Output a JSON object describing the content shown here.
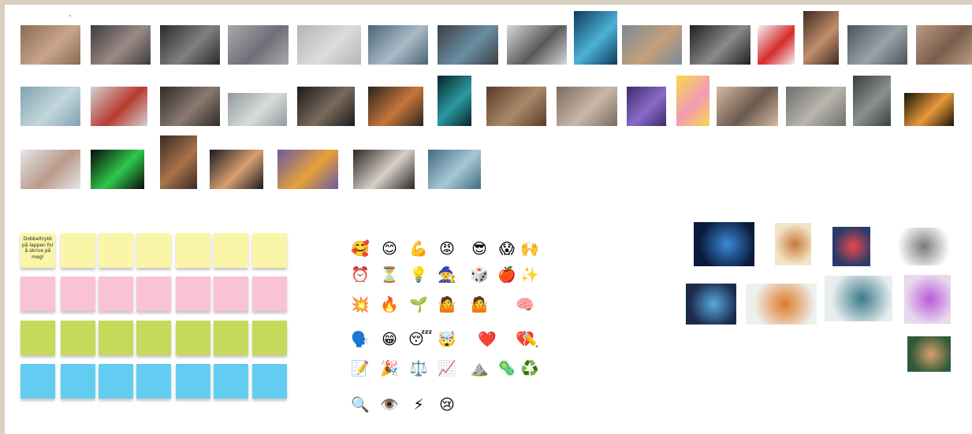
{
  "board": {
    "note_text": "Dobbeltrykk på lappen for å skrive på meg!",
    "note_colors": {
      "yellow": "#fbf5a8",
      "pink": "#f9c2d6",
      "green": "#c6d95a",
      "blue": "#63cdf1"
    }
  },
  "photos": [
    {
      "name": "photo-kids-classroom",
      "colors": [
        "#8b6a55",
        "#c9a58c"
      ]
    },
    {
      "name": "photo-people-phones",
      "colors": [
        "#3d3d3d",
        "#9a8a86"
      ]
    },
    {
      "name": "photo-audience-bw",
      "colors": [
        "#2a2a2a",
        "#808080"
      ]
    },
    {
      "name": "photo-laptop-hands",
      "colors": [
        "#a8a8ad",
        "#6f6f78"
      ]
    },
    {
      "name": "photo-blank-sign",
      "colors": [
        "#b5b5b5",
        "#dcdcdc"
      ]
    },
    {
      "name": "photo-ocean-figure",
      "colors": [
        "#4d6577",
        "#a9bbc6"
      ]
    },
    {
      "name": "photo-video-call",
      "colors": [
        "#3b3f44",
        "#6a8ea3"
      ]
    },
    {
      "name": "photo-shouting-kid",
      "colors": [
        "#d7d7d7",
        "#5a5a5a"
      ]
    },
    {
      "name": "photo-digital-touch",
      "colors": [
        "#0c3a5a",
        "#4db2d8"
      ]
    },
    {
      "name": "photo-desk-topdown",
      "colors": [
        "#7a8a99",
        "#c4a078"
      ]
    },
    {
      "name": "photo-raised-hand-bw",
      "colors": [
        "#1f1f1f",
        "#8a8a8a"
      ]
    },
    {
      "name": "photo-red-smoke",
      "colors": [
        "#f4f4f4",
        "#d62b2b"
      ]
    },
    {
      "name": "photo-phone-hand",
      "colors": [
        "#3d2a22",
        "#c28e6a"
      ]
    },
    {
      "name": "photo-handshake",
      "colors": [
        "#4d5358",
        "#9aa3a8"
      ]
    },
    {
      "name": "photo-newspapers",
      "colors": [
        "#b89c84",
        "#7a5e4c"
      ]
    },
    {
      "name": "photo-wall-what-now",
      "colors": [
        "#7fa3b0",
        "#c3d6dc"
      ]
    },
    {
      "name": "photo-apple-books",
      "colors": [
        "#cfd3d2",
        "#b83a30"
      ]
    },
    {
      "name": "photo-phone-closeup",
      "colors": [
        "#2f2a27",
        "#8a7a70"
      ]
    },
    {
      "name": "photo-empty-classroom",
      "colors": [
        "#8f9aa0",
        "#d8dcd8"
      ]
    },
    {
      "name": "photo-online-meeting",
      "colors": [
        "#1a1a1a",
        "#7b6a5c"
      ]
    },
    {
      "name": "photo-computer-desk",
      "colors": [
        "#2a2420",
        "#c7763b"
      ]
    },
    {
      "name": "photo-network-glow",
      "colors": [
        "#08232a",
        "#2a9aa0"
      ]
    },
    {
      "name": "photo-library-desk",
      "colors": [
        "#5a3a28",
        "#a88a6a"
      ]
    },
    {
      "name": "photo-kids-play",
      "colors": [
        "#7a6a60",
        "#c9b8a8"
      ]
    },
    {
      "name": "photo-vr-headset",
      "colors": [
        "#3b2c6b",
        "#8a6ac8"
      ]
    },
    {
      "name": "photo-yellow-pencil",
      "colors": [
        "#f7d84a",
        "#f29bb5"
      ]
    },
    {
      "name": "photo-classroom-kids",
      "colors": [
        "#d8b8a0",
        "#6a5a50"
      ]
    },
    {
      "name": "photo-lecture-hall",
      "colors": [
        "#6e6e6a",
        "#b8b5ad"
      ]
    },
    {
      "name": "photo-hopscotch",
      "colors": [
        "#3a3f3c",
        "#8b918d"
      ]
    },
    {
      "name": "photo-sparks",
      "colors": [
        "#1a1208",
        "#e89a3a"
      ]
    },
    {
      "name": "photo-tablet-hands",
      "colors": [
        "#e6e6e6",
        "#b89a8a"
      ]
    },
    {
      "name": "photo-signal-icons",
      "colors": [
        "#0a0a0a",
        "#2ec84a"
      ]
    },
    {
      "name": "photo-teen-laptop",
      "colors": [
        "#3a2a22",
        "#a8734a"
      ]
    },
    {
      "name": "photo-sunset-silhouette",
      "colors": [
        "#1a1a22",
        "#d8a070"
      ]
    },
    {
      "name": "photo-colorful-stars",
      "colors": [
        "#6a5aa0",
        "#e8a23a"
      ]
    },
    {
      "name": "photo-dancer-room",
      "colors": [
        "#2a2624",
        "#d8d0c8"
      ]
    },
    {
      "name": "photo-sea-person",
      "colors": [
        "#3f6a80",
        "#a8c8d6"
      ]
    }
  ],
  "emojis": [
    "🥰",
    "😊",
    "💪",
    "😡",
    "😎",
    "😱",
    "🙌",
    "⏰",
    "⏳",
    "💡",
    "🧙",
    "🎲",
    "🍎",
    "✨",
    "💥",
    "🔥",
    "🌱",
    "🤷",
    "🤷",
    "🧠",
    "🗣️",
    "😁",
    "😴",
    "🤯",
    "❤️",
    "💔",
    "✏️",
    "📝",
    "🎉",
    "⚖️",
    "📈",
    "⛰️",
    "🦠",
    "♻️",
    "🔍",
    "👁️",
    "⚡",
    "😢"
  ],
  "illustrations": [
    {
      "name": "illus-digital-finger",
      "colors": [
        "#0a1a3a",
        "#3a8ad8"
      ]
    },
    {
      "name": "illus-person-thinking",
      "colors": [
        "#f3e6c8",
        "#c87a3a"
      ]
    },
    {
      "name": "illus-brain-gears",
      "colors": [
        "#2a3a6a",
        "#e84a4a"
      ]
    },
    {
      "name": "illus-sketch-heads",
      "colors": [
        "#ffffff",
        "#7a7a7a"
      ]
    },
    {
      "name": "illus-hand-screen",
      "colors": [
        "#1a2a4a",
        "#5aa8e0"
      ]
    },
    {
      "name": "illus-online-graduation",
      "colors": [
        "#eef0ee",
        "#e07a2a"
      ]
    },
    {
      "name": "illus-two-heads-gears",
      "colors": [
        "#e8eef0",
        "#3a7a8a"
      ]
    },
    {
      "name": "illus-virtual-classroom",
      "colors": [
        "#e8d8f0",
        "#b85ad8"
      ]
    },
    {
      "name": "illus-kids-chalkboard",
      "colors": [
        "#2f5a3a",
        "#d8a06a"
      ]
    }
  ]
}
